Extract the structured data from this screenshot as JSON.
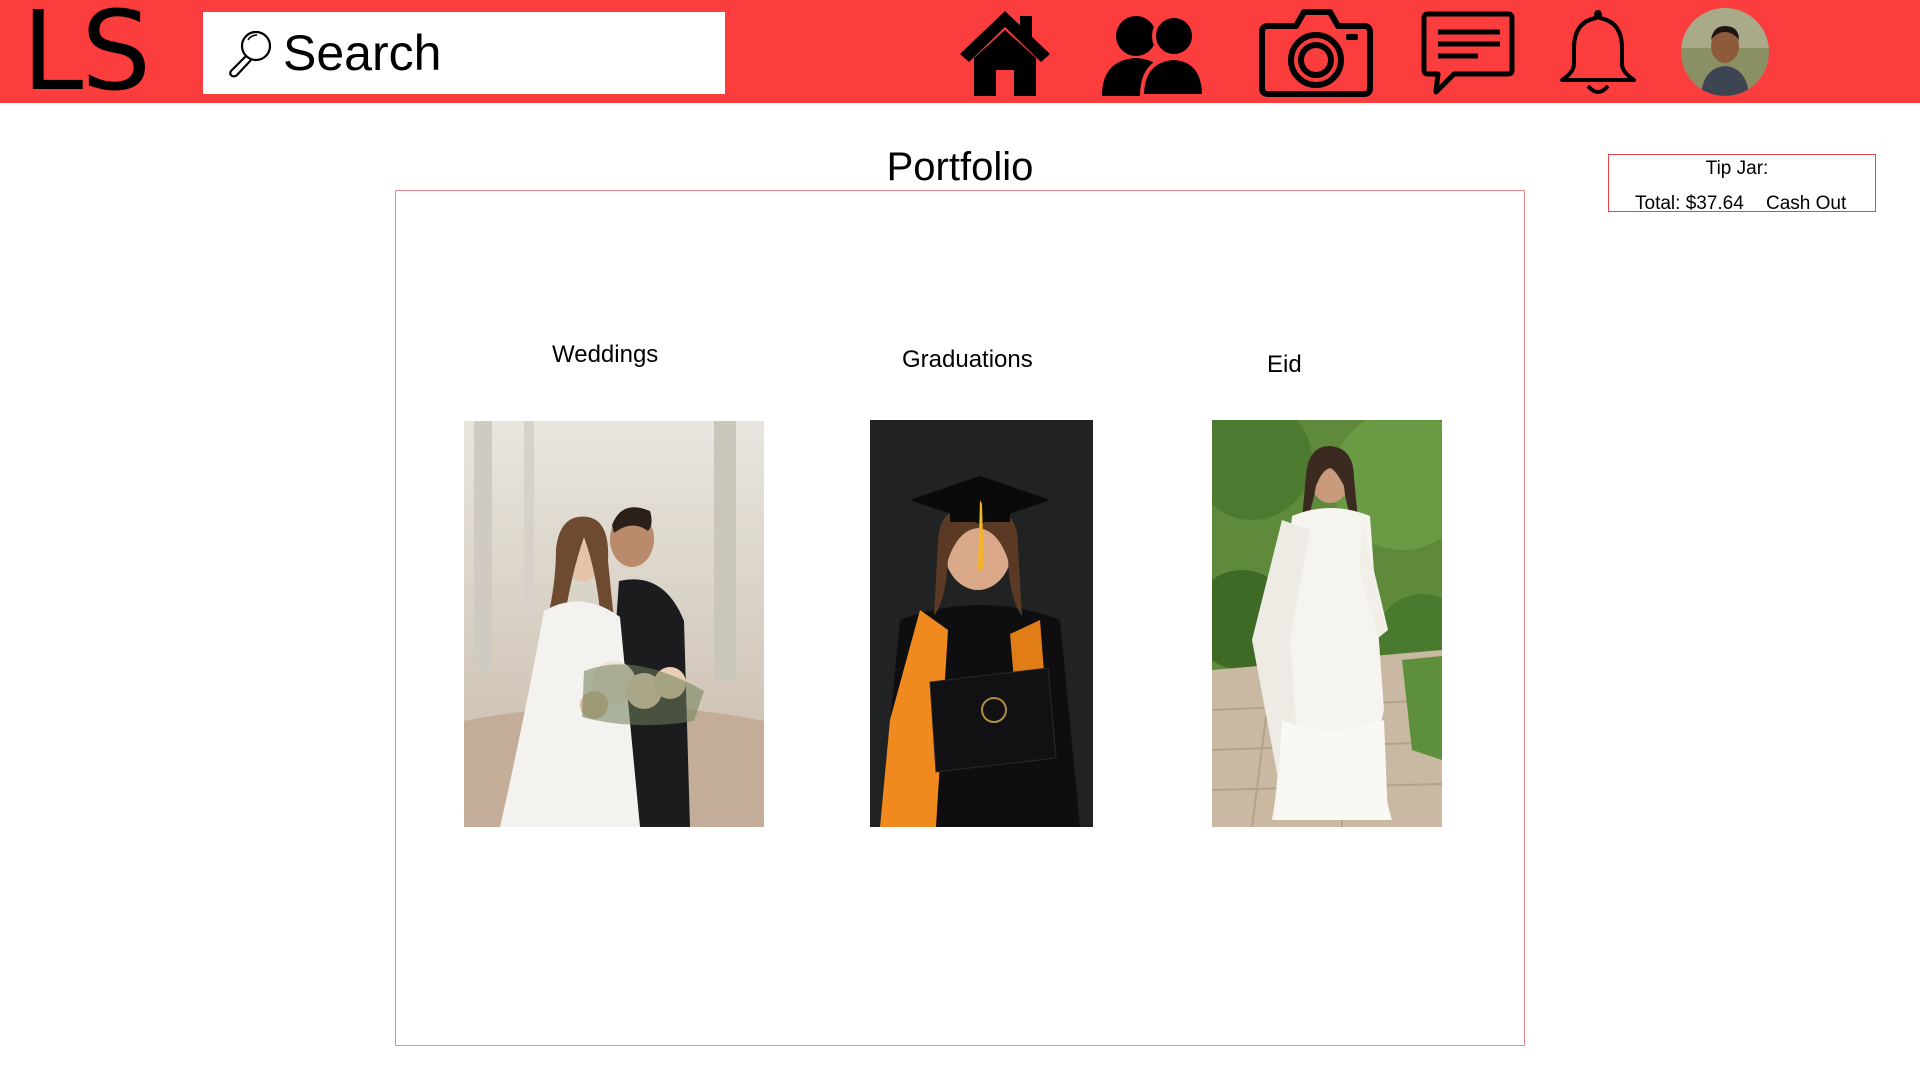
{
  "header": {
    "logo": "LS",
    "search_placeholder": "Search",
    "brand_color": "#fc3d3d",
    "nav_icons": [
      "home-icon",
      "friends-icon",
      "camera-icon",
      "messages-icon",
      "notifications-icon"
    ]
  },
  "tip_jar": {
    "title": "Tip Jar:",
    "total": "Total: $37.64",
    "cash_out": "Cash Out",
    "border_color": "#e64550"
  },
  "portfolio": {
    "title": "Portfolio",
    "categories": [
      {
        "label": "Weddings"
      },
      {
        "label": "Graduations"
      },
      {
        "label": "Eid"
      }
    ]
  }
}
